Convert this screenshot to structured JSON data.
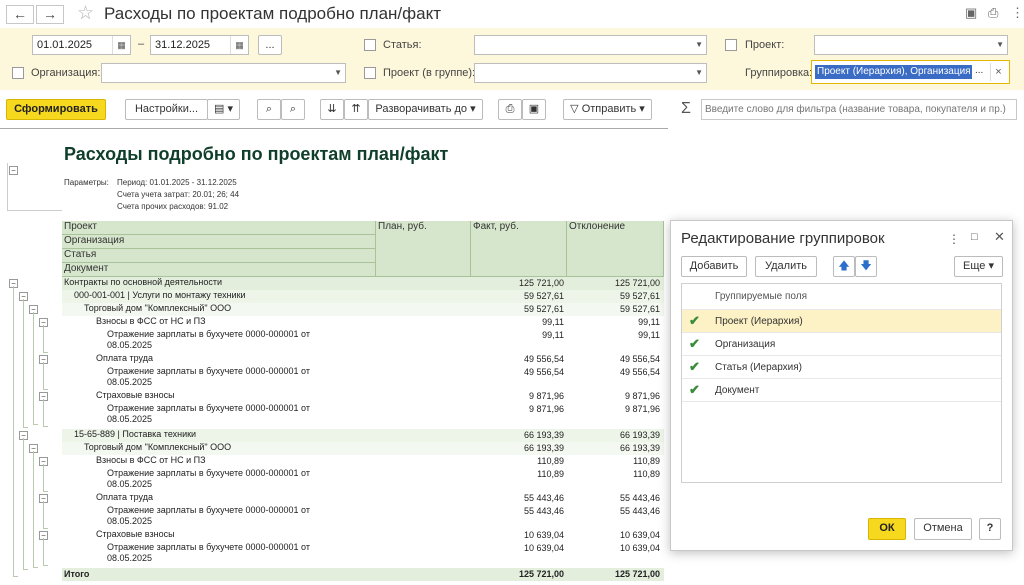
{
  "window": {
    "title": "Расходы по проектам подробно план/факт"
  },
  "filters": {
    "date_from": "01.01.2025",
    "date_sep": "–",
    "date_to": "31.12.2025",
    "more_btn": "...",
    "statya_label": "Статья:",
    "proekt_label": "Проект:",
    "organizaciya_label": "Организация:",
    "proekt_v_gruppe_label": "Проект (в группе):",
    "gruppirovka_label": "Группировка:",
    "gruppirovka_value": "Проект (Иерархия), Организация",
    "gruppirovka_more": "...",
    "gruppirovka_clear": "×"
  },
  "toolbar": {
    "sformirovat": "Сформировать",
    "nastroiki": "Настройки...",
    "razvorachivat": "Разворачивать до",
    "otpravit": "Отправить",
    "sigma": "Σ",
    "search_placeholder": "Введите слово для фильтра (название товара, покупателя и пр.)"
  },
  "report": {
    "title": "Расходы подробно по проектам план/факт",
    "params_label": "Параметры:",
    "param_period": "Период: 01.01.2025 - 31.12.2025",
    "param_scheta": "Счета учета затрат: 20.01; 26; 44",
    "param_prochie": "Счета прочих расходов: 91.02",
    "header": {
      "proekt": "Проект",
      "organizaciya": "Организация",
      "statya": "Статья",
      "dokument": "Документ",
      "plan": "План, руб.",
      "fakt": "Факт, руб.",
      "otkl": "Отклонение"
    },
    "rows": [
      {
        "name": "Контракты по основной деятельности",
        "line2": "",
        "plan": "",
        "fakt": "125 721,00",
        "otkl": "125 721,00"
      },
      {
        "name": "000-001-001 | Услуги по монтажу техники",
        "line2": "",
        "plan": "",
        "fakt": "59 527,61",
        "otkl": "59 527,61"
      },
      {
        "name": "Торговый дом \"Комплексный\" ООО",
        "line2": "",
        "plan": "",
        "fakt": "59 527,61",
        "otkl": "59 527,61"
      },
      {
        "name": "Взносы в ФСС от НС и ПЗ",
        "line2": "",
        "plan": "",
        "fakt": "99,11",
        "otkl": "99,11"
      },
      {
        "name": "Отражение зарплаты в бухучете 0000-000001 от",
        "line2": "08.05.2025",
        "plan": "",
        "fakt": "99,11",
        "otkl": "99,11"
      },
      {
        "name": "Оплата труда",
        "line2": "",
        "plan": "",
        "fakt": "49 556,54",
        "otkl": "49 556,54"
      },
      {
        "name": "Отражение зарплаты в бухучете 0000-000001 от",
        "line2": "08.05.2025",
        "plan": "",
        "fakt": "49 556,54",
        "otkl": "49 556,54"
      },
      {
        "name": "Страховые взносы",
        "line2": "",
        "plan": "",
        "fakt": "9 871,96",
        "otkl": "9 871,96"
      },
      {
        "name": "Отражение зарплаты в бухучете 0000-000001 от",
        "line2": "08.05.2025",
        "plan": "",
        "fakt": "9 871,96",
        "otkl": "9 871,96"
      },
      {
        "name": "15-65-889 | Поставка техники",
        "line2": "",
        "plan": "",
        "fakt": "66 193,39",
        "otkl": "66 193,39"
      },
      {
        "name": "Торговый дом \"Комплексный\" ООО",
        "line2": "",
        "plan": "",
        "fakt": "66 193,39",
        "otkl": "66 193,39"
      },
      {
        "name": "Взносы в ФСС от НС и ПЗ",
        "line2": "",
        "plan": "",
        "fakt": "110,89",
        "otkl": "110,89"
      },
      {
        "name": "Отражение зарплаты в бухучете 0000-000001 от",
        "line2": "08.05.2025",
        "plan": "",
        "fakt": "110,89",
        "otkl": "110,89"
      },
      {
        "name": "Оплата труда",
        "line2": "",
        "plan": "",
        "fakt": "55 443,46",
        "otkl": "55 443,46"
      },
      {
        "name": "Отражение зарплаты в бухучете 0000-000001 от",
        "line2": "08.05.2025",
        "plan": "",
        "fakt": "55 443,46",
        "otkl": "55 443,46"
      },
      {
        "name": "Страховые взносы",
        "line2": "",
        "plan": "",
        "fakt": "10 639,04",
        "otkl": "10 639,04"
      },
      {
        "name": "Отражение зарплаты в бухучете 0000-000001 от",
        "line2": "08.05.2025",
        "plan": "",
        "fakt": "10 639,04",
        "otkl": "10 639,04"
      }
    ],
    "total": {
      "name": "Итого",
      "plan": "",
      "fakt": "125 721,00",
      "otkl": "125 721,00"
    }
  },
  "dialog": {
    "title": "Редактирование группировок",
    "dobavit": "Добавить",
    "udalit": "Удалить",
    "eshche": "Еще",
    "list_header": "Группируемые поля",
    "items": [
      "Проект (Иерархия)",
      "Организация",
      "Статья (Иерархия)",
      "Документ"
    ],
    "ok": "ОК",
    "otmena": "Отмена",
    "help": "?"
  },
  "colors": {
    "accent": "#f6d81e",
    "filter_bg": "#fdf8dc",
    "table_header": "#d6e6cc",
    "title": "#0f3f2a",
    "selected_row": "#fdf2c5"
  }
}
